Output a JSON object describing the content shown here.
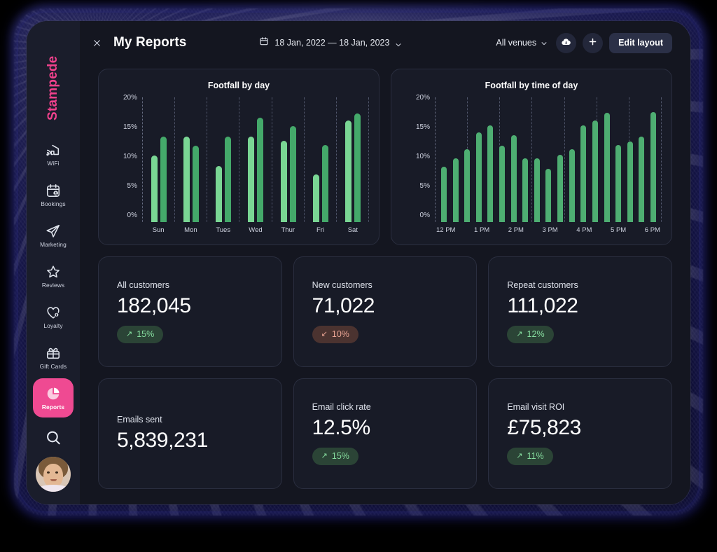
{
  "brand": {
    "name": "Stampede",
    "color": "#f0418c"
  },
  "sidebar": {
    "items": [
      {
        "label": "WiFi",
        "icon": "wifi-icon",
        "active": false
      },
      {
        "label": "Bookings",
        "icon": "calendar-user-icon",
        "active": false
      },
      {
        "label": "Marketing",
        "icon": "paper-plane-icon",
        "active": false
      },
      {
        "label": "Reviews",
        "icon": "star-icon",
        "active": false
      },
      {
        "label": "Loyalty",
        "icon": "heart-bolt-icon",
        "active": false
      },
      {
        "label": "Gift Cards",
        "icon": "gift-icon",
        "active": false
      },
      {
        "label": "Reports",
        "icon": "pie-chart-icon",
        "active": true
      }
    ],
    "search_icon": "search-icon",
    "avatar": "user-avatar"
  },
  "topbar": {
    "close_icon": "close-icon",
    "title": "My Reports",
    "calendar_icon": "calendar-icon",
    "date_range": "18 Jan, 2022 — 18 Jan, 2023",
    "date_chevron": "chevron-down-icon",
    "venue_filter": "All venues",
    "venue_chevron": "chevron-down-icon",
    "download_icon": "cloud-download-icon",
    "add_icon": "plus-icon",
    "edit_layout": "Edit layout"
  },
  "chart_data": [
    {
      "type": "bar",
      "title": "Footfall by day",
      "categories": [
        "Sun",
        "Mon",
        "Tues",
        "Wed",
        "Thur",
        "Fri",
        "Sat"
      ],
      "series": [
        {
          "name": "series-1",
          "color": "#7ad694",
          "values": [
            11.7,
            15.1,
            9.9,
            15.1,
            14.4,
            8.4,
            17.9
          ]
        },
        {
          "name": "series-2",
          "color": "#44a96a",
          "values": [
            15.1,
            13.5,
            15.1,
            18.4,
            16.9,
            13.6,
            19.2
          ]
        }
      ],
      "xlabel": "",
      "ylabel": "",
      "ylim": [
        0,
        22
      ],
      "yticks": [
        "0%",
        "5%",
        "10%",
        "15%",
        "20%"
      ],
      "grid": true,
      "legend": "none"
    },
    {
      "type": "bar",
      "title": "Footfall by time of day",
      "categories": [
        "12 PM",
        "",
        "",
        "1 PM",
        "",
        "",
        "2 PM",
        "",
        "",
        "3 PM",
        "",
        "",
        "4 PM",
        "",
        "",
        "5 PM",
        "",
        "",
        "6 PM"
      ],
      "tick_labels": [
        "12 PM",
        "1 PM",
        "2 PM",
        "3 PM",
        "4 PM",
        "5 PM",
        "6 PM"
      ],
      "values": [
        9.8,
        11.3,
        12.9,
        15.8,
        17.0,
        13.5,
        15.3,
        11.3,
        11.3,
        9.4,
        11.9,
        12.9,
        17.0,
        17.9,
        19.3,
        13.6,
        14.2,
        15.1,
        19.4
      ],
      "color": "#4eae72",
      "xlabel": "",
      "ylabel": "",
      "ylim": [
        0,
        22
      ],
      "yticks": [
        "0%",
        "5%",
        "10%",
        "15%",
        "20%"
      ],
      "grid": true,
      "legend": "none"
    }
  ],
  "stats": [
    {
      "label": "All customers",
      "value": "182,045",
      "badge": {
        "text": "15%",
        "direction": "up",
        "arrow": "↗"
      }
    },
    {
      "label": "New customers",
      "value": "71,022",
      "badge": {
        "text": "10%",
        "direction": "down",
        "arrow": "↙"
      }
    },
    {
      "label": "Repeat customers",
      "value": "111,022",
      "badge": {
        "text": "12%",
        "direction": "up",
        "arrow": "↗"
      }
    },
    {
      "label": "Emails sent",
      "value": "5,839,231",
      "badge": null
    },
    {
      "label": "Email click rate",
      "value": "12.5%",
      "badge": {
        "text": "15%",
        "direction": "up",
        "arrow": "↗"
      }
    },
    {
      "label": "Email visit ROI",
      "value": "£75,823",
      "badge": {
        "text": "11%",
        "direction": "up",
        "arrow": "↗"
      }
    }
  ],
  "theme": {
    "app_bg": "#141620",
    "sidebar_bg": "#1a1d2b",
    "card_bg": "#181b27",
    "card_border": "#2a2e3f",
    "accent_pink": "#ef4a92",
    "green_light": "#7ad694",
    "green_dark": "#44a96a",
    "badge_up_bg": "#2b4436",
    "badge_down_bg": "#4b3330"
  }
}
